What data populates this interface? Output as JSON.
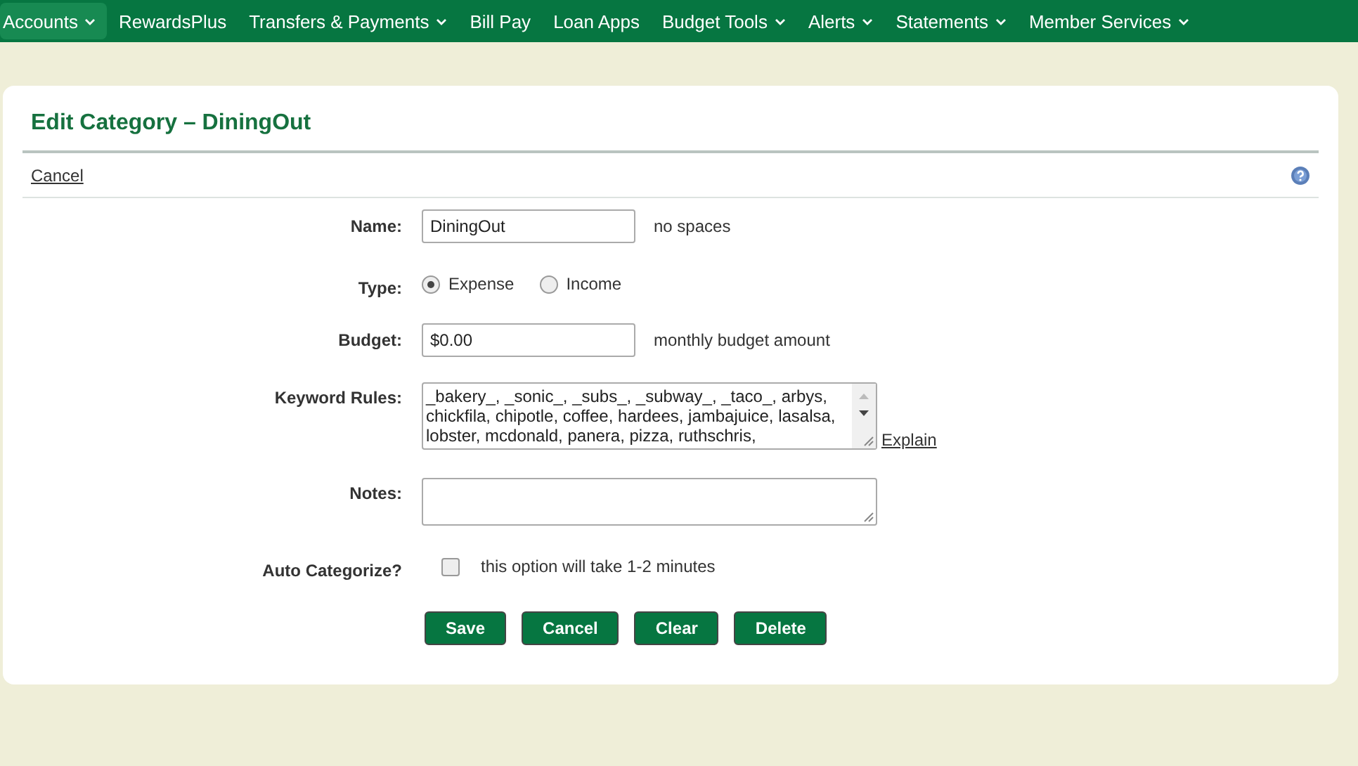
{
  "nav": [
    {
      "label": "Accounts",
      "dropdown": true,
      "selected": true
    },
    {
      "label": "RewardsPlus",
      "dropdown": false,
      "selected": false
    },
    {
      "label": "Transfers & Payments",
      "dropdown": true,
      "selected": false
    },
    {
      "label": "Bill Pay",
      "dropdown": false,
      "selected": false
    },
    {
      "label": "Loan Apps",
      "dropdown": false,
      "selected": false
    },
    {
      "label": "Budget Tools",
      "dropdown": true,
      "selected": false
    },
    {
      "label": "Alerts",
      "dropdown": true,
      "selected": false
    },
    {
      "label": "Statements",
      "dropdown": true,
      "selected": false
    },
    {
      "label": "Member Services",
      "dropdown": true,
      "selected": false
    }
  ],
  "title": "Edit Category – DiningOut",
  "cancel_link": "Cancel",
  "form": [
    {
      "kind": "text",
      "label": "Name:",
      "value": "DiningOut",
      "hint": "no spaces"
    },
    {
      "kind": "radio",
      "label": "Type:",
      "options": [
        {
          "label": "Expense",
          "selected": true
        },
        {
          "label": "Income",
          "selected": false
        }
      ]
    },
    {
      "kind": "text",
      "label": "Budget:",
      "value": "$0.00",
      "hint": "monthly budget amount"
    },
    {
      "kind": "textarea",
      "label": "Keyword Rules:",
      "value": "_bakery_, _sonic_, _subs_, _subway_, _taco_, arbys, chickfila, chipotle, coffee, hardees, jambajuice, lasalsa, lobster, mcdonald, panera, pizza, ruthschris,",
      "link": "Explain"
    },
    {
      "kind": "textarea",
      "label": "Notes:"
    },
    {
      "kind": "checkbox",
      "label": "Auto Categorize?",
      "checked": false,
      "hint": "this option will take 1-2 minutes"
    }
  ],
  "buttons": [
    "Save",
    "Cancel",
    "Clear",
    "Delete"
  ]
}
